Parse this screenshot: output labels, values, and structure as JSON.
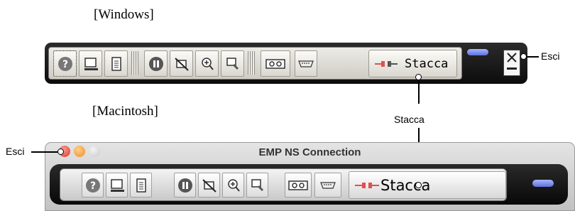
{
  "headings": {
    "windows": "[Windows]",
    "macintosh": "[Macintosh]"
  },
  "callouts": {
    "esci_windows": "Esci",
    "stacca": "Stacca",
    "esci_mac": "Esci"
  },
  "windows_toolbar": {
    "buttons": [
      "help-icon",
      "display-icon",
      "document-icon",
      "pause-icon",
      "no-display-icon",
      "zoom-icon",
      "tools-icon",
      "video-icon",
      "serial-icon"
    ],
    "stacca_label": "Stacca",
    "close_icon": "close-icon"
  },
  "mac_window": {
    "title": "EMP NS Connection",
    "traffic_lights": [
      "#e0493f",
      "#f7a53a",
      "#d3d3d3"
    ],
    "stacca_label": "Stacca"
  },
  "colors": {
    "bar": "#111111",
    "accent_pill": "#6f80ea"
  }
}
